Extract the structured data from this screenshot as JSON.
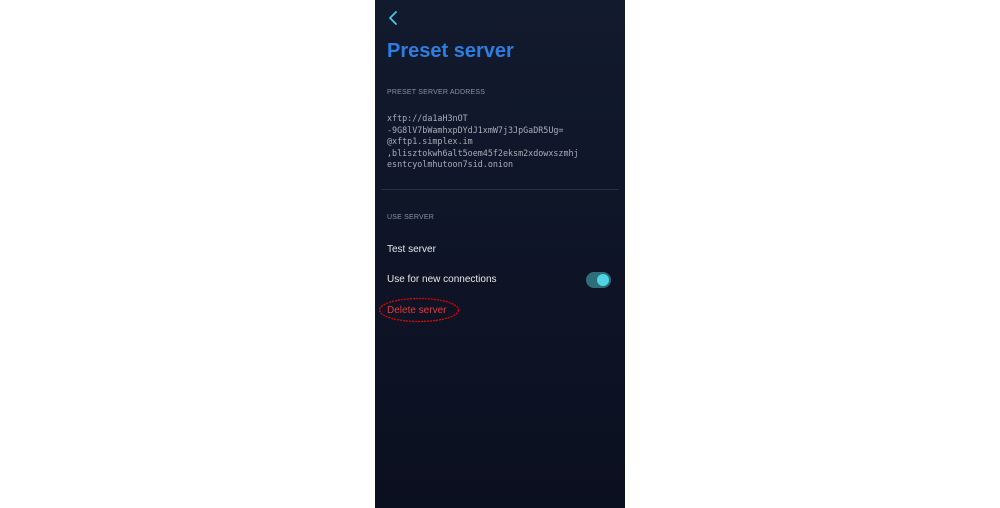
{
  "header": {
    "back_icon": "chevron-left-icon",
    "title": "Preset server"
  },
  "address_section": {
    "label": "PRESET SERVER ADDRESS",
    "lines": [
      "xftp://da1aH3nOT",
      "-9G8lV7bWamhxpDYdJ1xmW7j3JpGaDR5Ug=",
      "@xftp1.simplex.im",
      ",blisztokwh6alt5oem45f2eksm2xdowxszmhj",
      "esntcyolmhutoon7sid.onion"
    ]
  },
  "use_section": {
    "label": "USE SERVER",
    "test_server": "Test server",
    "use_for_new_connections": "Use for new connections",
    "use_for_new_connections_enabled": true,
    "delete_server": "Delete server"
  },
  "colors": {
    "title": "#2f7de0",
    "toggle_knob": "#4fd4e4",
    "delete": "#e33b3b",
    "annotation_ellipse": "#e00000"
  }
}
